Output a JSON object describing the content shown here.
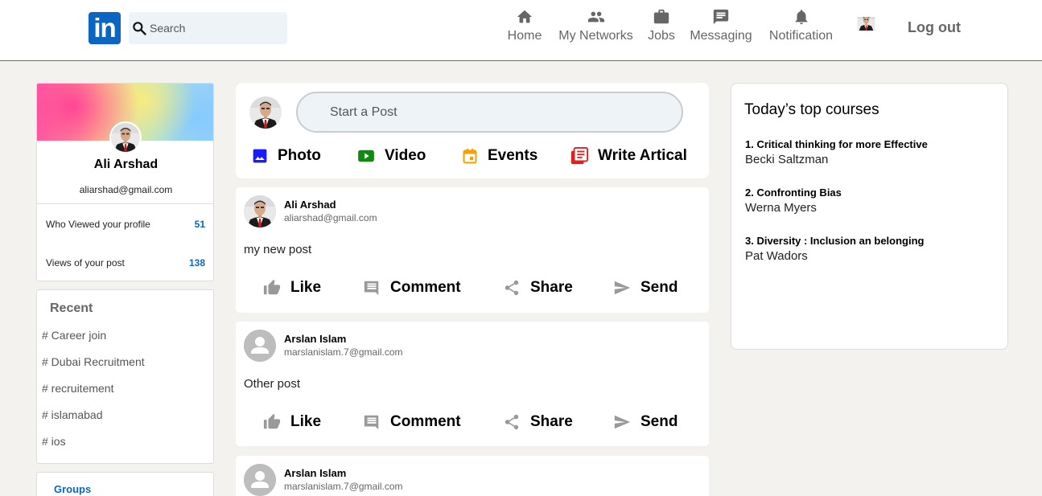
{
  "header": {
    "logo_text": "in",
    "search_placeholder": "Search",
    "nav": [
      {
        "label": "Home",
        "icon": "home-icon"
      },
      {
        "label": "My Networks",
        "icon": "people-icon"
      },
      {
        "label": "Jobs",
        "icon": "briefcase-icon"
      },
      {
        "label": "Messaging",
        "icon": "message-icon"
      },
      {
        "label": "Notification",
        "icon": "bell-icon"
      }
    ],
    "logout_label": "Log out"
  },
  "profile": {
    "name": "Ali Arshad",
    "email": "aliarshad@gmail.com",
    "stats": [
      {
        "label": "Who Viewed your profile",
        "value": "51"
      },
      {
        "label": "Views of your post",
        "value": "138"
      }
    ]
  },
  "recent": {
    "title": "Recent",
    "items": [
      "# Career join",
      "# Dubai Recruitment",
      "# recruitement",
      "# islamabad",
      "# ios"
    ]
  },
  "groups": {
    "title": "Groups"
  },
  "composer": {
    "placeholder": "Start a Post",
    "actions": [
      {
        "label": "Photo",
        "icon": "photo-icon",
        "color": "#1a1aff"
      },
      {
        "label": "Video",
        "icon": "video-icon",
        "color": "#128a12"
      },
      {
        "label": "Events",
        "icon": "calendar-icon",
        "color": "#f5a200"
      },
      {
        "label": "Write Artical",
        "icon": "article-icon",
        "color": "#e02020"
      }
    ]
  },
  "posts": [
    {
      "name": "Ali Arshad",
      "email": "aliarshad@gmail.com",
      "text": "my new post"
    },
    {
      "name": "Arslan Islam",
      "email": "marslanislam.7@gmail.com",
      "text": "Other post"
    },
    {
      "name": "Arslan Islam",
      "email": "marslanislam.7@gmail.com",
      "text": ""
    }
  ],
  "post_actions": [
    "Like",
    "Comment",
    "Share",
    "Send"
  ],
  "courses": {
    "title": "Today’s top courses",
    "items": [
      {
        "title": "1. Critical thinking for more Effective",
        "author": "Becki Saltzman"
      },
      {
        "title": "2. Confronting Bias",
        "author": "Werna Myers"
      },
      {
        "title": "3. Diversity : Inclusion an belonging",
        "author": "Pat Wadors"
      }
    ]
  }
}
